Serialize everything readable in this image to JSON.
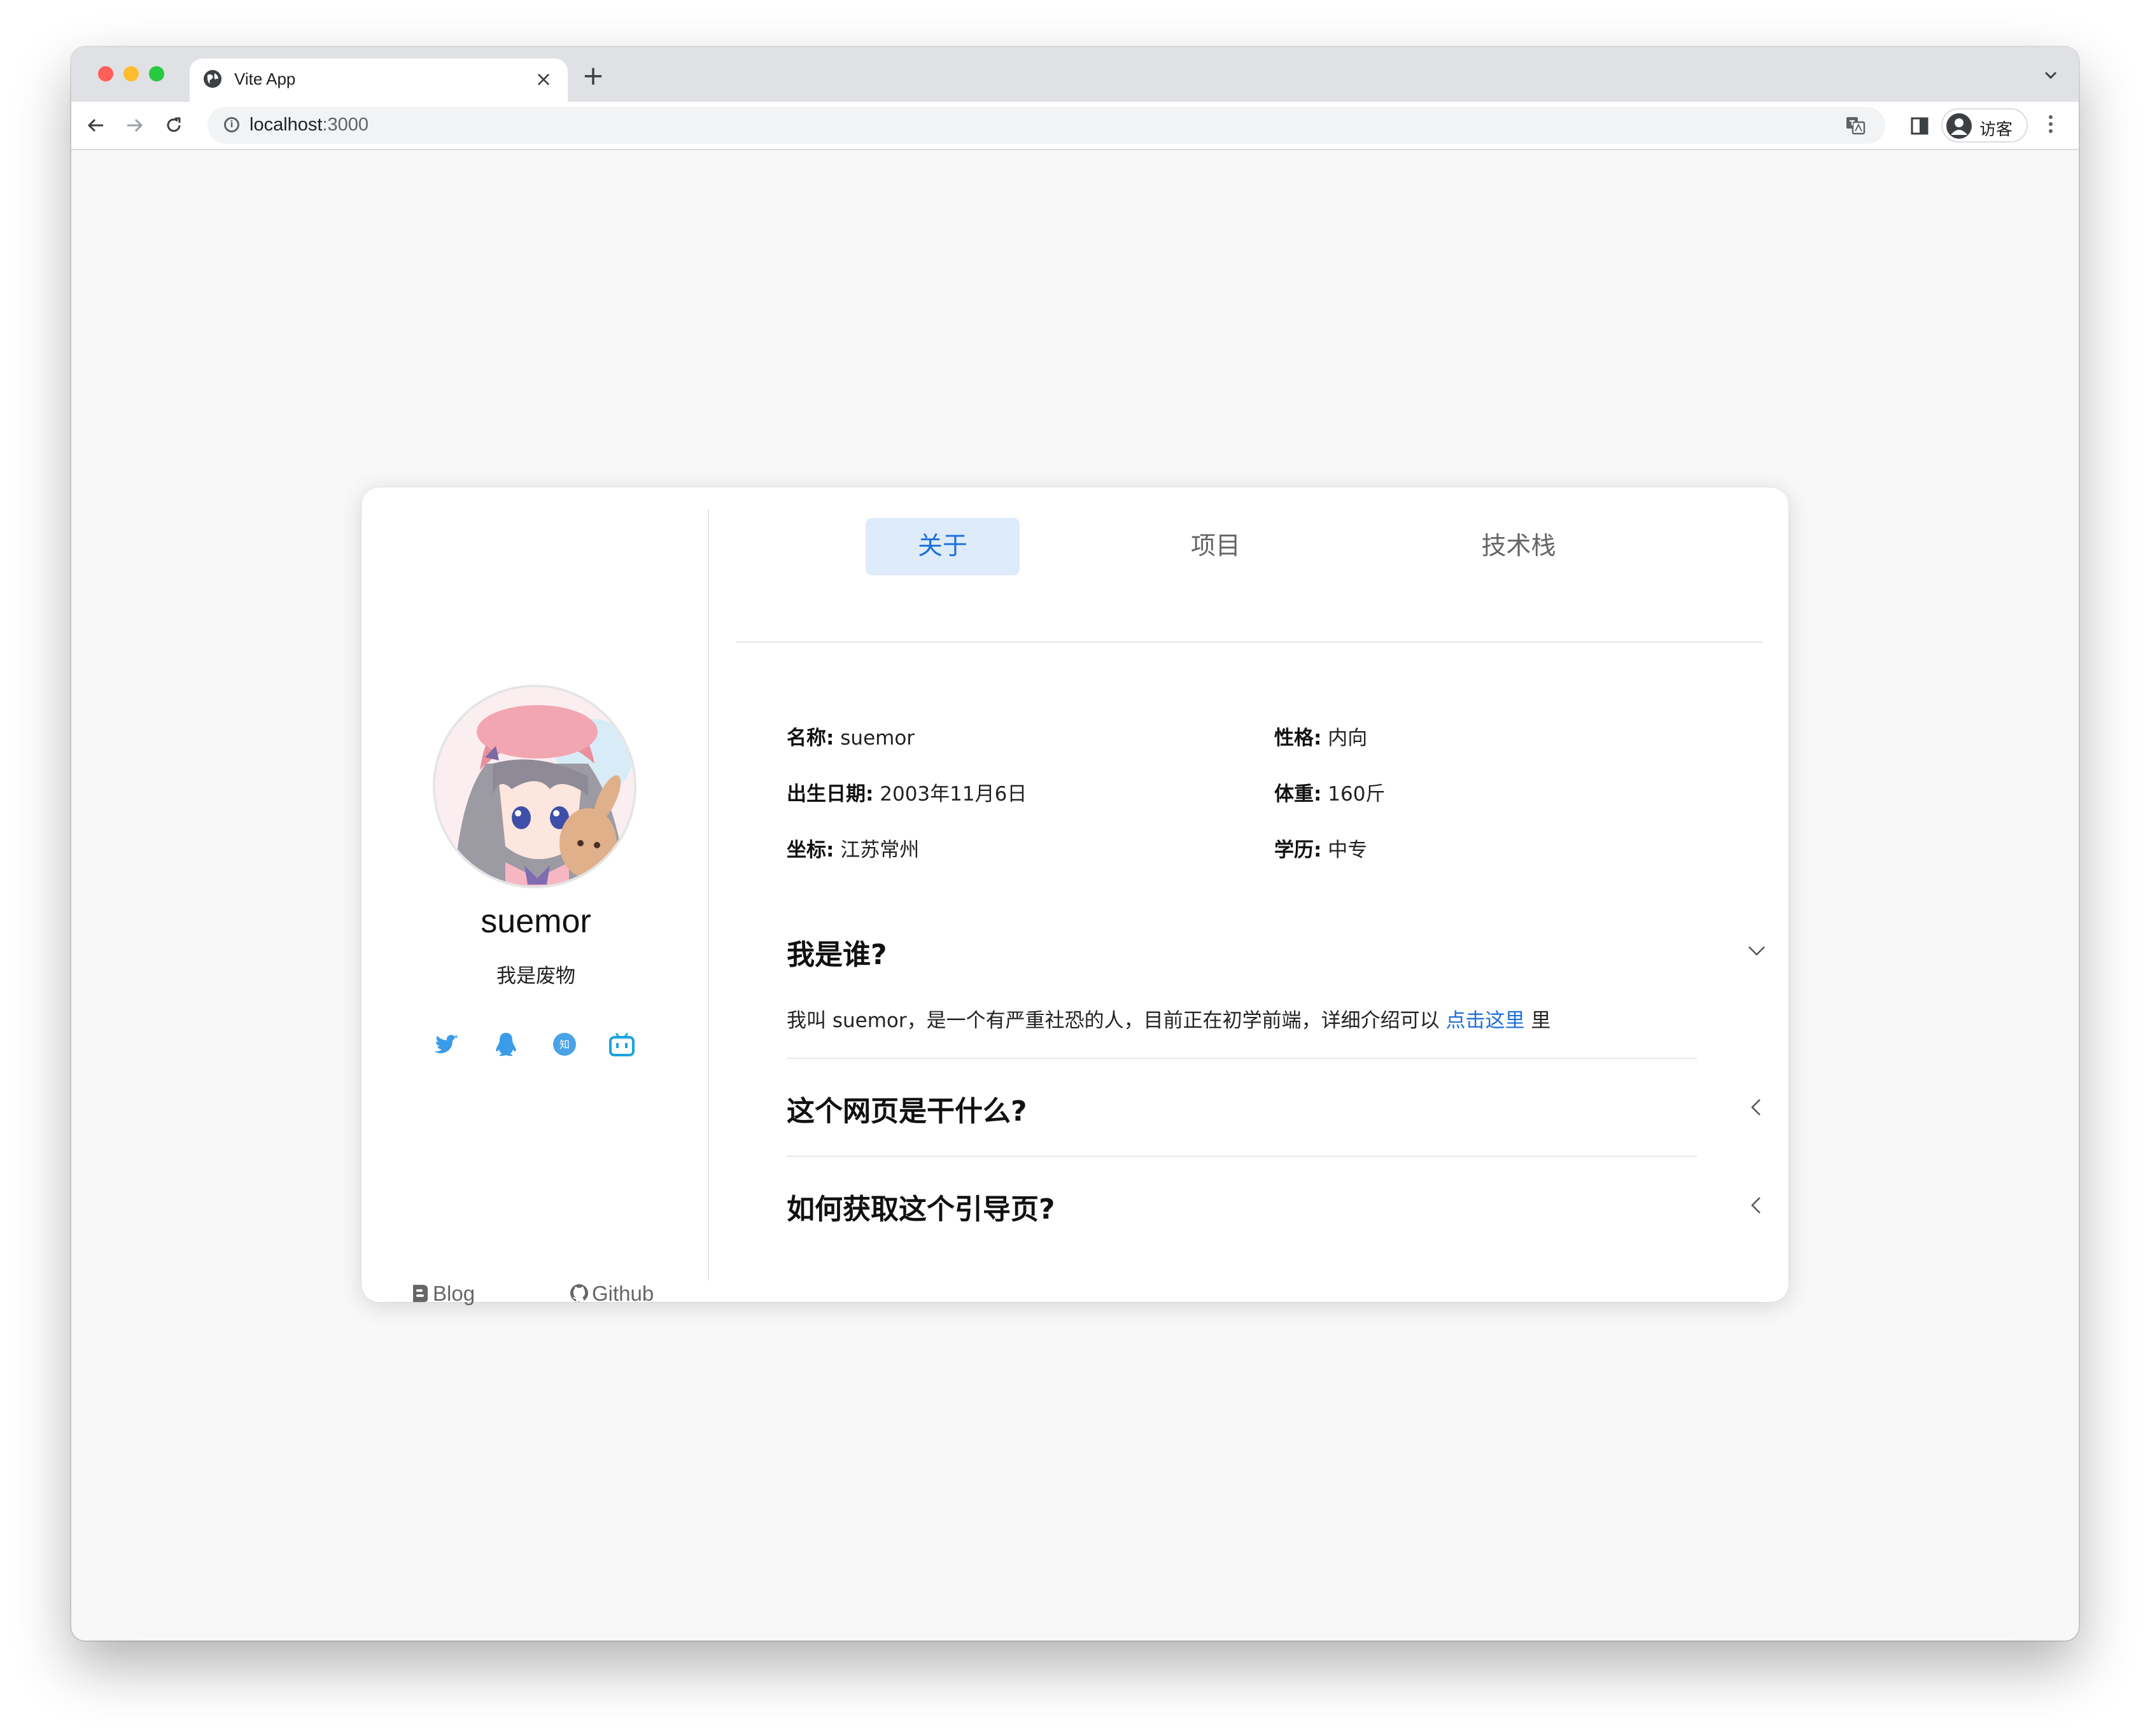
{
  "browser": {
    "tab_title": "Vite App",
    "url_host": "localhost",
    "url_port": ":3000",
    "profile_label": "访客",
    "new_tab_glyph": "+",
    "close_glyph": "×"
  },
  "sidebar": {
    "username": "suemor",
    "subtitle": "我是废物",
    "social_icons": [
      "twitter-icon",
      "qq-icon",
      "zhihu-icon",
      "bilibili-icon"
    ],
    "links": [
      {
        "label": "Blog",
        "icon": "blog-icon"
      },
      {
        "label": "Github",
        "icon": "github-icon"
      }
    ]
  },
  "tabs": [
    {
      "label": "关于",
      "active": true
    },
    {
      "label": "项目",
      "active": false
    },
    {
      "label": "技术栈",
      "active": false
    }
  ],
  "info": [
    {
      "key": "名称:",
      "value": "suemor"
    },
    {
      "key": "性格:",
      "value": "内向"
    },
    {
      "key": "出生日期:",
      "value": "2003年11月6日"
    },
    {
      "key": "体重:",
      "value": "160斤"
    },
    {
      "key": "坐标:",
      "value": "江苏常州"
    },
    {
      "key": "学历:",
      "value": "中专"
    }
  ],
  "faq": [
    {
      "question": "我是谁?",
      "expanded": true,
      "answer_prefix": "我叫 suemor，是一个有严重社恐的人，目前正在初学前端，详细介绍可以 ",
      "answer_link": "点击这里",
      "answer_suffix": " 里"
    },
    {
      "question": "这个网页是干什么?",
      "expanded": false
    },
    {
      "question": "如何获取这个引导页?",
      "expanded": false
    }
  ],
  "colors": {
    "accent": "#1e6fd9",
    "active_tab_bg": "#deebfa",
    "social_blue": "#3a9be8",
    "bilibili_blue": "#1aa3e0"
  }
}
